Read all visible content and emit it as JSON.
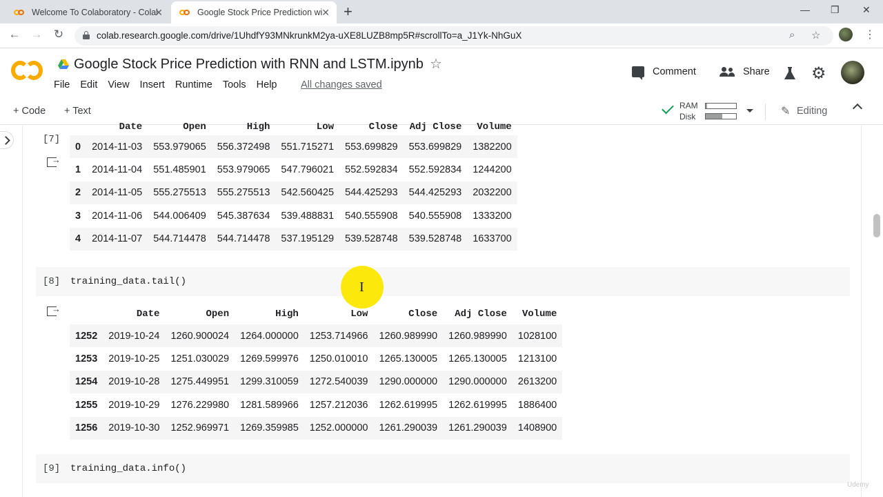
{
  "browser": {
    "tabs": [
      {
        "label": "Welcome To Colaboratory - Colab",
        "active": false
      },
      {
        "label": "Google Stock Price Prediction wi",
        "active": true
      }
    ],
    "new_tab_icon": "+",
    "url": "colab.research.google.com/drive/1UhdfY93MNkrunkM2ya-uXE8LUZB8mp5R#scrollTo=a_J1Yk-NhGuX"
  },
  "colab": {
    "title": "Google Stock Price Prediction with RNN and LSTM.ipynb",
    "menu": [
      "File",
      "Edit",
      "View",
      "Insert",
      "Runtime",
      "Tools",
      "Help"
    ],
    "save_status": "All changes saved",
    "comment_label": "Comment",
    "share_label": "Share",
    "add_code": "+ Code",
    "add_text": "+ Text",
    "ram_label": "RAM",
    "disk_label": "Disk",
    "ram_usage": 0.05,
    "disk_usage": 0.55,
    "editing_label": "Editing",
    "accent": "#f9ab00"
  },
  "cells": {
    "c7": {
      "prompt": "[7]",
      "columns": [
        "",
        "Date",
        "Open",
        "High",
        "Low",
        "Close",
        "Adj Close",
        "Volume"
      ],
      "rows": [
        [
          "0",
          "2014-11-03",
          "553.979065",
          "556.372498",
          "551.715271",
          "553.699829",
          "553.699829",
          "1382200"
        ],
        [
          "1",
          "2014-11-04",
          "551.485901",
          "553.979065",
          "547.796021",
          "552.592834",
          "552.592834",
          "1244200"
        ],
        [
          "2",
          "2014-11-05",
          "555.275513",
          "555.275513",
          "542.560425",
          "544.425293",
          "544.425293",
          "2032200"
        ],
        [
          "3",
          "2014-11-06",
          "544.006409",
          "545.387634",
          "539.488831",
          "540.555908",
          "540.555908",
          "1333200"
        ],
        [
          "4",
          "2014-11-07",
          "544.714478",
          "544.714478",
          "537.195129",
          "539.528748",
          "539.528748",
          "1633700"
        ]
      ]
    },
    "c8": {
      "prompt": "[8]",
      "code": "training_data.tail()",
      "columns": [
        "",
        "Date",
        "Open",
        "High",
        "Low",
        "Close",
        "Adj Close",
        "Volume"
      ],
      "rows": [
        [
          "1252",
          "2019-10-24",
          "1260.900024",
          "1264.000000",
          "1253.714966",
          "1260.989990",
          "1260.989990",
          "1028100"
        ],
        [
          "1253",
          "2019-10-25",
          "1251.030029",
          "1269.599976",
          "1250.010010",
          "1265.130005",
          "1265.130005",
          "1213100"
        ],
        [
          "1254",
          "2019-10-28",
          "1275.449951",
          "1299.310059",
          "1272.540039",
          "1290.000000",
          "1290.000000",
          "2613200"
        ],
        [
          "1255",
          "2019-10-29",
          "1276.229980",
          "1281.589966",
          "1257.212036",
          "1262.619995",
          "1262.619995",
          "1886400"
        ],
        [
          "1256",
          "2019-10-30",
          "1252.969971",
          "1269.359985",
          "1252.000000",
          "1261.290039",
          "1261.290039",
          "1408900"
        ]
      ]
    },
    "c9": {
      "prompt": "[9]",
      "code": "training_data.info()"
    }
  }
}
